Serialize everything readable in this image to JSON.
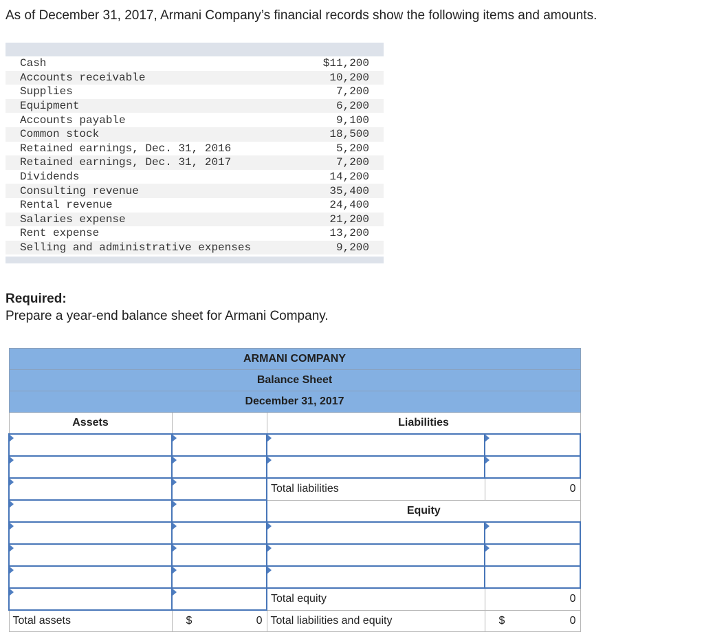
{
  "intro": "As of December 31, 2017, Armani Company’s financial records show the following items and amounts.",
  "items": [
    {
      "label": "Cash",
      "value": "$11,200"
    },
    {
      "label": "Accounts receivable",
      "value": "10,200"
    },
    {
      "label": "Supplies",
      "value": "7,200"
    },
    {
      "label": "Equipment",
      "value": "6,200"
    },
    {
      "label": "Accounts payable",
      "value": "9,100"
    },
    {
      "label": "Common stock",
      "value": "18,500"
    },
    {
      "label": "Retained earnings, Dec. 31, 2016",
      "value": "5,200"
    },
    {
      "label": "Retained earnings, Dec. 31, 2017",
      "value": "7,200"
    },
    {
      "label": "Dividends",
      "value": "14,200"
    },
    {
      "label": "Consulting revenue",
      "value": "35,400"
    },
    {
      "label": "Rental revenue",
      "value": "24,400"
    },
    {
      "label": "Salaries expense",
      "value": "21,200"
    },
    {
      "label": "Rent expense",
      "value": "13,200"
    },
    {
      "label": "Selling and administrative expenses",
      "value": "9,200"
    }
  ],
  "required": {
    "title": "Required:",
    "text": "Prepare a year-end balance sheet for Armani Company."
  },
  "sheet": {
    "company": "ARMANI COMPANY",
    "title": "Balance Sheet",
    "date": "December 31, 2017",
    "assets_header": "Assets",
    "liabilities_header": "Liabilities",
    "equity_header": "Equity",
    "total_liabilities_label": "Total liabilities",
    "total_liabilities_value": "0",
    "total_equity_label": "Total equity",
    "total_equity_value": "0",
    "total_assets_label": "Total assets",
    "total_assets_symbol": "$",
    "total_assets_value": "0",
    "total_liab_equity_label": "Total liabilities and equity",
    "total_liab_equity_symbol": "$",
    "total_liab_equity_value": "0"
  }
}
